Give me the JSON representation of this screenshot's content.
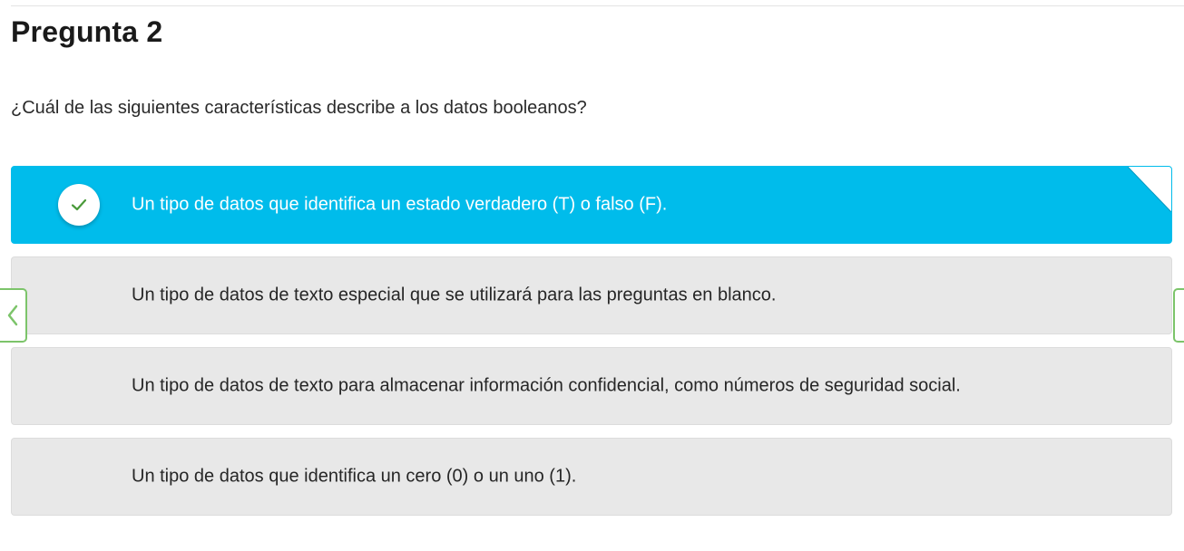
{
  "quiz": {
    "title": "Pregunta 2",
    "question": "¿Cuál de las siguientes características describe a los datos booleanos?",
    "options": [
      {
        "label": "Un tipo de datos que identifica un estado verdadero (T) o falso (F).",
        "selected": true
      },
      {
        "label": "Un tipo de datos de texto especial que se utilizará para las preguntas en blanco.",
        "selected": false
      },
      {
        "label": "Un tipo de datos de texto para almacenar información confidencial, como números de seguridad social.",
        "selected": false
      },
      {
        "label": "Un tipo de datos que identifica un cero (0) o un uno (1).",
        "selected": false
      }
    ]
  },
  "navigation": {
    "prev_icon": "chevron-left-icon",
    "next_icon": "chevron-right-icon"
  },
  "colors": {
    "selected_background": "#00bceb",
    "option_background": "#e8e8e8",
    "check_color": "#4a9a3a",
    "nav_border": "#7cc46a"
  }
}
